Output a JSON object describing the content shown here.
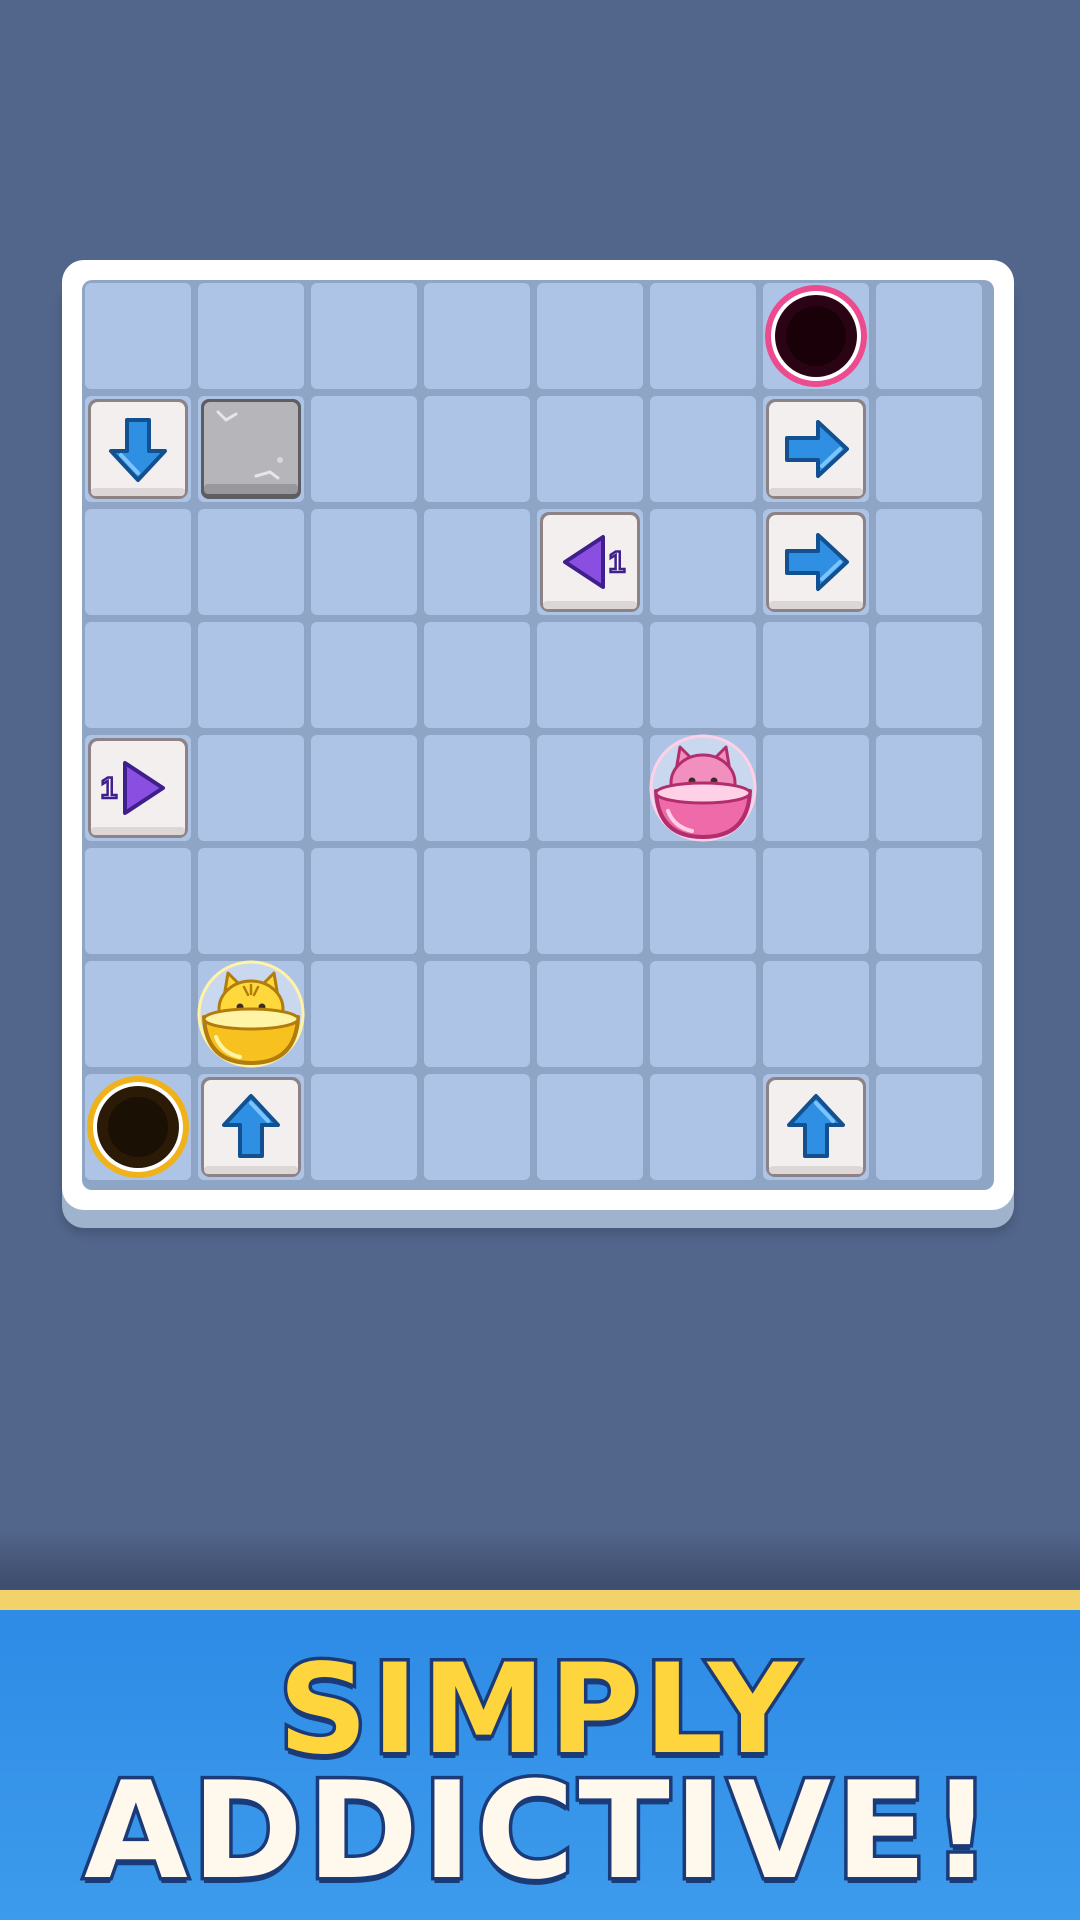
{
  "headline": {
    "line1": "SIMPLY",
    "line2": "ADDICTIVE!"
  },
  "colors": {
    "background": "#52658b",
    "board": "#ffffff",
    "cell": "#aec4e7",
    "arrow_blue": "#2f8fe3",
    "arrow_purple": "#8a4fe0",
    "hole_pink": "#ec4c8f",
    "hole_gold": "#f0b21a",
    "cat_pink": "#f38fbf",
    "cat_yellow": "#ffd93b",
    "banner": "#2e8be6",
    "headline_yellow": "#ffd53d"
  },
  "board": {
    "rows": 8,
    "cols": 8,
    "pieces": [
      {
        "type": "hole",
        "color": "pink",
        "row": 0,
        "col": 6
      },
      {
        "type": "arrow",
        "dir": "down",
        "color": "blue",
        "row": 1,
        "col": 0
      },
      {
        "type": "stone",
        "row": 1,
        "col": 1
      },
      {
        "type": "arrow",
        "dir": "right",
        "color": "blue",
        "row": 1,
        "col": 6
      },
      {
        "type": "arrow",
        "dir": "left",
        "color": "purple",
        "count": "1",
        "row": 2,
        "col": 4
      },
      {
        "type": "arrow",
        "dir": "right",
        "color": "blue",
        "row": 2,
        "col": 6
      },
      {
        "type": "arrow",
        "dir": "right",
        "color": "purple",
        "count": "1",
        "row": 4,
        "col": 0
      },
      {
        "type": "cat",
        "color": "pink",
        "row": 4,
        "col": 5
      },
      {
        "type": "cat",
        "color": "yellow",
        "row": 6,
        "col": 1
      },
      {
        "type": "hole",
        "color": "gold",
        "row": 7,
        "col": 0
      },
      {
        "type": "arrow",
        "dir": "up",
        "color": "blue",
        "row": 7,
        "col": 1
      },
      {
        "type": "arrow",
        "dir": "up",
        "color": "blue",
        "row": 7,
        "col": 6
      }
    ]
  }
}
